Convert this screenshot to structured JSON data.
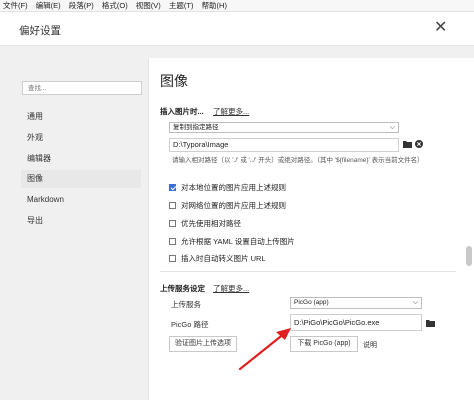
{
  "menu": [
    "文件(F)",
    "编辑(E)",
    "段落(P)",
    "格式(O)",
    "视图(V)",
    "主题(T)",
    "帮助(H)"
  ],
  "dialog": {
    "title": "偏好设置",
    "close": "✕"
  },
  "sidebar": {
    "search_placeholder": "查找...",
    "items": [
      {
        "label": "通用",
        "active": false
      },
      {
        "label": "外观",
        "active": false
      },
      {
        "label": "编辑器",
        "active": false
      },
      {
        "label": "图像",
        "active": true
      },
      {
        "label": "Markdown",
        "active": false
      },
      {
        "label": "导出",
        "active": false
      }
    ]
  },
  "main": {
    "title": "图像",
    "insert": {
      "heading": "插入图片时...",
      "learn_more": "了解更多...",
      "action_select": "复制到指定路径",
      "path_value": "D:\\Typora\\Image",
      "hint": "请输入相对路径（以 './' 或 '../' 开头）或绝对路径。（其中 '${filename}' 表示当前文件名）",
      "options": [
        {
          "label": "对本地位置的图片应用上述规则",
          "checked": true
        },
        {
          "label": "对网络位置的图片应用上述规则",
          "checked": false
        },
        {
          "label": "优先使用相对路径",
          "checked": false
        },
        {
          "label": "允许根据 YAML 设置自动上传图片",
          "checked": false
        },
        {
          "label": "插入时自动转义图片 URL",
          "checked": false
        }
      ]
    },
    "upload": {
      "heading": "上传服务设定",
      "learn_more": "了解更多...",
      "service_label": "上传服务",
      "service_value": "PicGo (app)",
      "path_label": "PicGo 路径",
      "path_value": "D:\\PiGo\\PicGo\\PicGo.exe",
      "verify_button": "验证图片上传选项",
      "download_button": "下载 PicGo (app)",
      "help_link": "说明"
    }
  },
  "icons": {
    "folder": "folder-icon",
    "close_circle": "clear-path-icon"
  },
  "colors": {
    "annotation_arrow": "#e02020",
    "checkbox_accent": "#3b6fd8"
  }
}
